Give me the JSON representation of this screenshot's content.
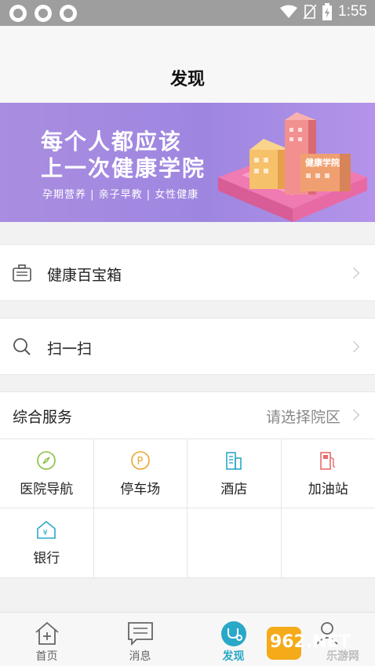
{
  "status_bar": {
    "time": "1:55"
  },
  "header": {
    "title": "发现"
  },
  "banner": {
    "line1": "每个人都应该",
    "line2": "上一次健康学院",
    "subtitle": "孕期营养 | 亲子早教 | 女性健康",
    "building_sign": "健康学院"
  },
  "rows": [
    {
      "label": "健康百宝箱",
      "icon": "toolbox-icon"
    },
    {
      "label": "扫一扫",
      "icon": "search-icon"
    }
  ],
  "services": {
    "title": "综合服务",
    "picker": "请选择院区",
    "items": [
      {
        "label": "医院导航",
        "icon": "compass-icon",
        "color": "#8bbf3f"
      },
      {
        "label": "停车场",
        "icon": "parking-icon",
        "color": "#e8a62c"
      },
      {
        "label": "酒店",
        "icon": "hotel-icon",
        "color": "#2aa8c8"
      },
      {
        "label": "加油站",
        "icon": "gas-station-icon",
        "color": "#e86a6a"
      },
      {
        "label": "银行",
        "icon": "bank-icon",
        "color": "#2aa8c8"
      }
    ]
  },
  "bottom_nav": {
    "tabs": [
      {
        "label": "首页",
        "icon": "home-icon"
      },
      {
        "label": "消息",
        "icon": "message-icon"
      },
      {
        "label": "发现",
        "icon": "discover-icon",
        "active": true
      }
    ]
  },
  "watermark": {
    "brand": "962.NET",
    "site": "乐游网"
  },
  "colors": {
    "accent": "#2aa8c8",
    "banner": "#a98de0"
  }
}
